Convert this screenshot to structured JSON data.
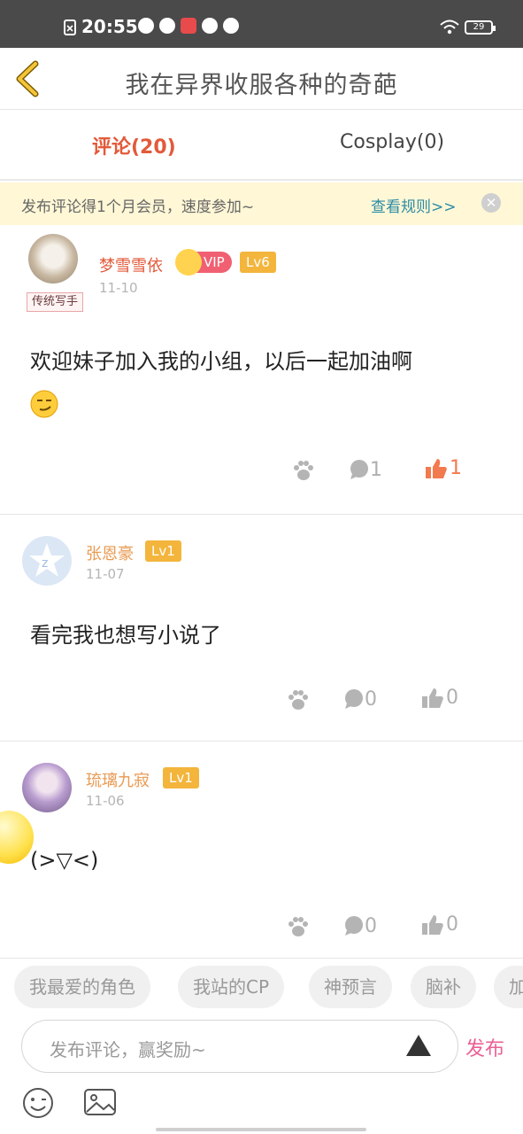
{
  "status": {
    "time": "20:55",
    "battery": "29"
  },
  "nav": {
    "title": "我在异界收服各种的奇葩"
  },
  "tabs": [
    {
      "label": "评论(20)",
      "active": true
    },
    {
      "label": "Cosplay(0)",
      "active": false
    }
  ],
  "banner": {
    "text": "发布评论得1个月会员，速度参加~",
    "rule": "查看规则>>"
  },
  "comments": [
    {
      "name": "梦雪雪依",
      "vip": "VIP",
      "level": "Lv6",
      "date": "11-10",
      "badge": "传统写手",
      "text": "欢迎妹子加入我的小组，以后一起加油啊",
      "reply_count": "1",
      "like_count": "1"
    },
    {
      "name": "张恩豪",
      "level": "Lv1",
      "date": "11-07",
      "text": "看完我也想写小说了",
      "reply_count": "0",
      "like_count": "0"
    },
    {
      "name": "琉璃九寂",
      "level": "Lv1",
      "date": "11-06",
      "text": "(>▽<)",
      "reply_count": "0",
      "like_count": "0"
    }
  ],
  "chips": [
    "我最爱的角色",
    "我站的CP",
    "神预言",
    "脑补",
    "加"
  ],
  "input": {
    "placeholder": "发布评论，赢奖励~",
    "publish": "发布"
  },
  "colors": {
    "accent": "#e25a3a",
    "publish": "#e96193",
    "banner_bg": "#fff7d6",
    "level": "#f3b53c",
    "vip": "#f06072"
  }
}
